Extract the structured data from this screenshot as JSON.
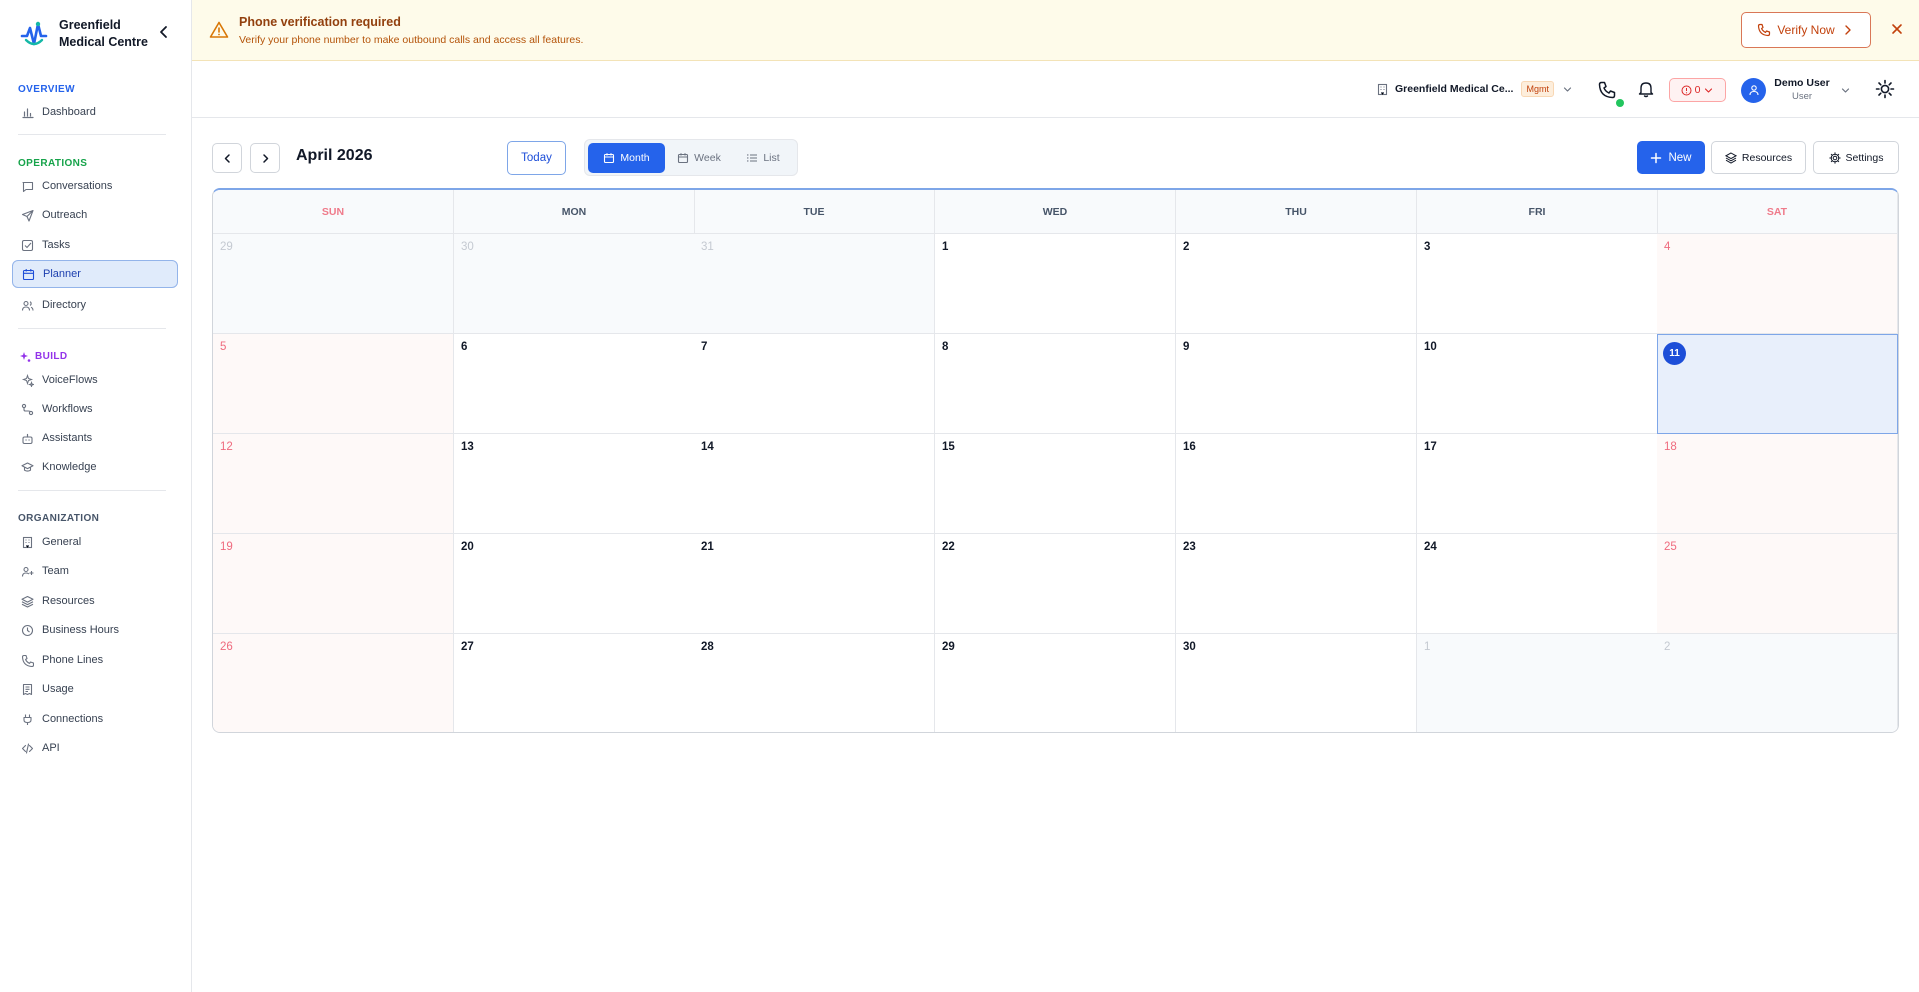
{
  "brand": {
    "name": "Greenfield Medical Centre"
  },
  "sidebar": {
    "sections": [
      {
        "title": "OVERVIEW",
        "color": "#2563eb",
        "items": [
          {
            "label": "Dashboard",
            "icon": "bar-chart-icon"
          }
        ]
      },
      {
        "title": "OPERATIONS",
        "color": "#16a34a",
        "items": [
          {
            "label": "Conversations",
            "icon": "message-square-icon"
          },
          {
            "label": "Outreach",
            "icon": "send-icon"
          },
          {
            "label": "Tasks",
            "icon": "check-square-icon"
          },
          {
            "label": "Planner",
            "icon": "calendar-icon",
            "active": true
          },
          {
            "label": "Directory",
            "icon": "users-icon"
          }
        ]
      },
      {
        "title": "BUILD",
        "color": "#9333ea",
        "items": [
          {
            "label": "VoiceFlows",
            "icon": "sparkles-icon"
          },
          {
            "label": "Workflows",
            "icon": "workflow-icon"
          },
          {
            "label": "Assistants",
            "icon": "bot-icon"
          },
          {
            "label": "Knowledge",
            "icon": "graduation-cap-icon"
          }
        ]
      },
      {
        "title": "ORGANIZATION",
        "color": "#475569",
        "items": [
          {
            "label": "General",
            "icon": "building-icon"
          },
          {
            "label": "Team",
            "icon": "user-plus-icon"
          },
          {
            "label": "Resources",
            "icon": "layers-icon"
          },
          {
            "label": "Business Hours",
            "icon": "clock-icon"
          },
          {
            "label": "Phone Lines",
            "icon": "phone-icon"
          },
          {
            "label": "Usage",
            "icon": "receipt-icon"
          },
          {
            "label": "Connections",
            "icon": "plug-icon"
          },
          {
            "label": "API",
            "icon": "code-icon"
          }
        ]
      }
    ]
  },
  "banner": {
    "title": "Phone verification required",
    "text": "Verify your phone number to make outbound calls and access all features.",
    "button": "Verify Now"
  },
  "header": {
    "org_name": "Greenfield Medical Ce...",
    "org_badge": "Mgmt",
    "alert_count": "0",
    "user_name": "Demo User",
    "user_role": "User"
  },
  "toolbar": {
    "month_title": "April 2026",
    "today": "Today",
    "views": [
      "Month",
      "Week",
      "List"
    ],
    "active_view": "Month",
    "new": "New",
    "resources": "Resources",
    "settings": "Settings"
  },
  "calendar": {
    "weekdays": [
      "SUN",
      "MON",
      "TUE",
      "WED",
      "THU",
      "FRI",
      "SAT"
    ],
    "weeks": [
      [
        "29",
        "30",
        "31",
        "1",
        "2",
        "3",
        "4"
      ],
      [
        "5",
        "6",
        "7",
        "8",
        "9",
        "10",
        "11"
      ],
      [
        "12",
        "13",
        "14",
        "15",
        "16",
        "17",
        "18"
      ],
      [
        "19",
        "20",
        "21",
        "22",
        "23",
        "24",
        "25"
      ],
      [
        "26",
        "27",
        "28",
        "29",
        "30",
        "1",
        "2"
      ]
    ],
    "today": "11"
  },
  "colors": {
    "accent": "#2563eb",
    "warning": "#b45309",
    "weekend": "#ef6b7e"
  }
}
